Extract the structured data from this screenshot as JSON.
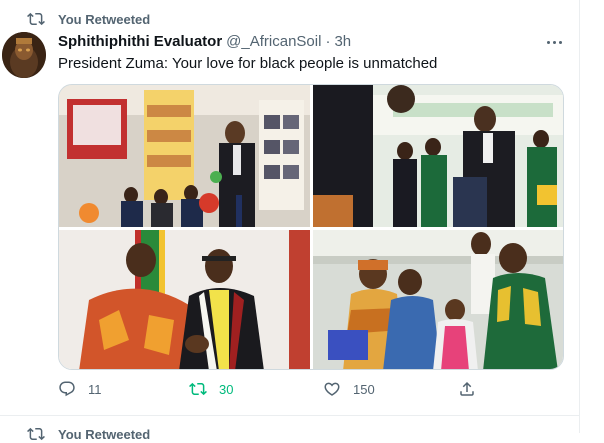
{
  "retweet_context": {
    "label": "You Retweeted",
    "icon": "retweet-icon"
  },
  "tweet": {
    "author_name": "Sphithiphithi Evaluator",
    "author_handle": "@_AfricanSoil",
    "separator": "·",
    "timestamp": "3h",
    "text": "President Zuma: Your love for black people is unmatched",
    "media": [
      {
        "icon": "photo-image",
        "description": "event booth with bookshelf and children"
      },
      {
        "icon": "photo-image",
        "description": "man greeting schoolchildren in green uniforms"
      },
      {
        "icon": "photo-image",
        "description": "graduate in gown greeting man in red shirt"
      },
      {
        "icon": "photo-image",
        "description": "crowd of women and children at outdoor event"
      }
    ],
    "actions": {
      "reply_count": "11",
      "retweet_count": "30",
      "like_count": "150"
    }
  },
  "next_context": {
    "label": "You Retweeted"
  },
  "colors": {
    "accent_green": "#00ba7c",
    "secondary_text": "#536471",
    "primary_text": "#0f1419",
    "border": "#cfd9de"
  }
}
